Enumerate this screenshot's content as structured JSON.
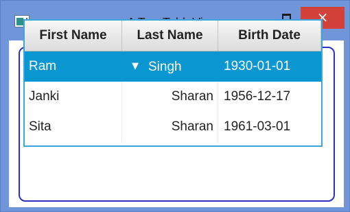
{
  "window": {
    "title": "A TreeTableView",
    "controls": {
      "minimize": "–",
      "maximize": "□",
      "close": "×"
    },
    "icon": "java-app-icon"
  },
  "table": {
    "columns": [
      "First Name",
      "Last Name",
      "Birth Date"
    ],
    "rows": [
      {
        "first": "Ram",
        "last": "Singh",
        "birth": "1930-01-01",
        "expanded": true,
        "selected": true,
        "disclosure": "▼"
      },
      {
        "first": "Janki",
        "last": "Sharan",
        "birth": "1956-12-17"
      },
      {
        "first": "Sita",
        "last": "Sharan",
        "birth": "1961-03-01"
      }
    ]
  },
  "colors": {
    "window_frame": "#7195d9",
    "close_button": "#d2423b",
    "selection": "#0a96d0",
    "table_border": "#3aa6de",
    "outer_frame": "#2b2fc0"
  }
}
